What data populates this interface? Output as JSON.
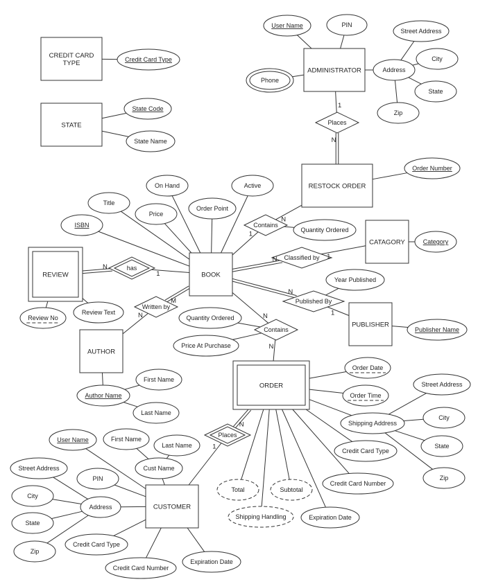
{
  "diagram": {
    "type": "entity-relationship",
    "entities": [
      {
        "id": "credit_card_type",
        "label_lines": [
          "CREDIT CARD",
          "TYPE"
        ],
        "weak": false
      },
      {
        "id": "state",
        "label_lines": [
          "STATE"
        ],
        "weak": false
      },
      {
        "id": "administrator",
        "label_lines": [
          "ADMINISTRATOR"
        ],
        "weak": false
      },
      {
        "id": "restock_order",
        "label_lines": [
          "RESTOCK ORDER"
        ],
        "weak": false
      },
      {
        "id": "catagory",
        "label_lines": [
          "CATAGORY"
        ],
        "weak": false
      },
      {
        "id": "book",
        "label_lines": [
          "BOOK"
        ],
        "weak": false
      },
      {
        "id": "review",
        "label_lines": [
          "REVIEW"
        ],
        "weak": true
      },
      {
        "id": "author",
        "label_lines": [
          "AUTHOR"
        ],
        "weak": false
      },
      {
        "id": "publisher",
        "label_lines": [
          "PUBLISHER"
        ],
        "weak": false
      },
      {
        "id": "order",
        "label_lines": [
          "ORDER"
        ],
        "weak": true
      },
      {
        "id": "customer",
        "label_lines": [
          "CUSTOMER"
        ],
        "weak": false
      }
    ],
    "relationships": [
      {
        "id": "admin_places",
        "label": "Places",
        "identifying": false
      },
      {
        "id": "restock_contains",
        "label": "Contains",
        "identifying": false
      },
      {
        "id": "classified_by",
        "label": "Classified by",
        "identifying": false
      },
      {
        "id": "has",
        "label": "has",
        "identifying": true
      },
      {
        "id": "written_by",
        "label": "Written by",
        "identifying": false
      },
      {
        "id": "published_by",
        "label": "Published By",
        "identifying": false
      },
      {
        "id": "order_contains",
        "label": "Contains",
        "identifying": false
      },
      {
        "id": "customer_places",
        "label": "Places",
        "identifying": true
      }
    ],
    "attributes": [
      {
        "id": "cct_type",
        "label": "Credit Card Type",
        "kind": "key"
      },
      {
        "id": "state_code",
        "label": "State Code",
        "kind": "key"
      },
      {
        "id": "state_name",
        "label": "State Name",
        "kind": "normal"
      },
      {
        "id": "admin_user",
        "label": "User Name",
        "kind": "key"
      },
      {
        "id": "admin_pin",
        "label": "PIN",
        "kind": "normal"
      },
      {
        "id": "admin_phone",
        "label": "Phone",
        "kind": "multivalued"
      },
      {
        "id": "admin_address",
        "label": "Address",
        "kind": "normal"
      },
      {
        "id": "admin_street",
        "label": "Street Address",
        "kind": "normal"
      },
      {
        "id": "admin_city",
        "label": "City",
        "kind": "normal"
      },
      {
        "id": "admin_state",
        "label": "State",
        "kind": "normal"
      },
      {
        "id": "admin_zip",
        "label": "Zip",
        "kind": "normal"
      },
      {
        "id": "order_number",
        "label": "Order Number",
        "kind": "key"
      },
      {
        "id": "restock_qty",
        "label": "Quantity Ordered",
        "kind": "normal"
      },
      {
        "id": "category",
        "label": "Category",
        "kind": "key"
      },
      {
        "id": "on_hand",
        "label": "On Hand",
        "kind": "normal"
      },
      {
        "id": "active",
        "label": "Active",
        "kind": "normal"
      },
      {
        "id": "title",
        "label": "Title",
        "kind": "normal"
      },
      {
        "id": "price",
        "label": "Price",
        "kind": "normal"
      },
      {
        "id": "order_point",
        "label": "Order Point",
        "kind": "normal"
      },
      {
        "id": "isbn",
        "label": "ISBN",
        "kind": "key"
      },
      {
        "id": "review_no",
        "label": "Review No",
        "kind": "partial-key"
      },
      {
        "id": "review_text",
        "label": "Review Text",
        "kind": "normal"
      },
      {
        "id": "author_name",
        "label": "Author Name",
        "kind": "key"
      },
      {
        "id": "author_first",
        "label": "First Name",
        "kind": "normal"
      },
      {
        "id": "author_last",
        "label": "Last Name",
        "kind": "normal"
      },
      {
        "id": "year_published",
        "label": "Year Published",
        "kind": "normal"
      },
      {
        "id": "publisher_name",
        "label": "Publisher Name",
        "kind": "key"
      },
      {
        "id": "oc_qty",
        "label": "Quantity Ordered",
        "kind": "normal"
      },
      {
        "id": "price_at_purchase",
        "label": "Price At Purchase",
        "kind": "normal"
      },
      {
        "id": "order_date",
        "label": "Order Date",
        "kind": "partial-key"
      },
      {
        "id": "order_time",
        "label": "Order Time",
        "kind": "partial-key"
      },
      {
        "id": "ship_address",
        "label": "Shipping Address",
        "kind": "normal"
      },
      {
        "id": "ship_street",
        "label": "Street Address",
        "kind": "normal"
      },
      {
        "id": "ship_city",
        "label": "City",
        "kind": "normal"
      },
      {
        "id": "ship_state",
        "label": "State",
        "kind": "normal"
      },
      {
        "id": "ship_zip",
        "label": "Zip",
        "kind": "normal"
      },
      {
        "id": "order_cc_type",
        "label": "Credit Card Type",
        "kind": "normal"
      },
      {
        "id": "order_cc_number",
        "label": "Credit Card Number",
        "kind": "normal"
      },
      {
        "id": "order_total",
        "label": "Total",
        "kind": "derived"
      },
      {
        "id": "order_subtotal",
        "label": "Subtotal",
        "kind": "derived"
      },
      {
        "id": "order_shipping",
        "label": "Shipping Handling",
        "kind": "derived"
      },
      {
        "id": "order_exp",
        "label": "Expiration Date",
        "kind": "normal"
      },
      {
        "id": "cust_user",
        "label": "User Name",
        "kind": "key"
      },
      {
        "id": "cust_first",
        "label": "First Name",
        "kind": "normal"
      },
      {
        "id": "cust_last",
        "label": "Last Name",
        "kind": "normal"
      },
      {
        "id": "cust_name",
        "label": "Cust Name",
        "kind": "normal"
      },
      {
        "id": "cust_pin",
        "label": "PIN",
        "kind": "normal"
      },
      {
        "id": "cust_street",
        "label": "Street Address",
        "kind": "normal"
      },
      {
        "id": "cust_city",
        "label": "City",
        "kind": "normal"
      },
      {
        "id": "cust_address",
        "label": "Address",
        "kind": "normal"
      },
      {
        "id": "cust_state",
        "label": "State",
        "kind": "normal"
      },
      {
        "id": "cust_zip",
        "label": "Zip",
        "kind": "normal"
      },
      {
        "id": "cust_cc_type",
        "label": "Credit Card Type",
        "kind": "normal"
      },
      {
        "id": "cust_cc_number",
        "label": "Credit Card Number",
        "kind": "normal"
      },
      {
        "id": "cust_exp",
        "label": "Expiration Date",
        "kind": "normal"
      }
    ],
    "links": [
      {
        "from": "credit_card_type",
        "to": "cct_type"
      },
      {
        "from": "state",
        "to": "state_code"
      },
      {
        "from": "state",
        "to": "state_name"
      },
      {
        "from": "administrator",
        "to": "admin_user"
      },
      {
        "from": "administrator",
        "to": "admin_pin"
      },
      {
        "from": "administrator",
        "to": "admin_phone"
      },
      {
        "from": "administrator",
        "to": "admin_address"
      },
      {
        "from": "admin_address",
        "to": "admin_street"
      },
      {
        "from": "admin_address",
        "to": "admin_city"
      },
      {
        "from": "admin_address",
        "to": "admin_state"
      },
      {
        "from": "admin_address",
        "to": "admin_zip"
      },
      {
        "from": "administrator",
        "to": "admin_places",
        "cardinality": "1"
      },
      {
        "from": "admin_places",
        "to": "restock_order",
        "cardinality": "N",
        "total": true
      },
      {
        "from": "restock_order",
        "to": "order_number"
      },
      {
        "from": "restock_order",
        "to": "restock_contains",
        "cardinality": "N"
      },
      {
        "from": "restock_contains",
        "to": "book",
        "cardinality": "1"
      },
      {
        "from": "restock_contains",
        "to": "restock_qty"
      },
      {
        "from": "catagory",
        "to": "category"
      },
      {
        "from": "catagory",
        "to": "classified_by",
        "cardinality": "1"
      },
      {
        "from": "classified_by",
        "to": "book",
        "cardinality": "N",
        "total": true
      },
      {
        "from": "book",
        "to": "on_hand"
      },
      {
        "from": "book",
        "to": "active"
      },
      {
        "from": "book",
        "to": "title"
      },
      {
        "from": "book",
        "to": "price"
      },
      {
        "from": "book",
        "to": "order_point"
      },
      {
        "from": "book",
        "to": "isbn"
      },
      {
        "from": "book",
        "to": "has",
        "cardinality": "1"
      },
      {
        "from": "has",
        "to": "review",
        "cardinality": "N",
        "total": true
      },
      {
        "from": "review",
        "to": "review_no"
      },
      {
        "from": "review",
        "to": "review_text"
      },
      {
        "from": "book",
        "to": "written_by",
        "cardinality": "M",
        "total": true
      },
      {
        "from": "written_by",
        "to": "author",
        "cardinality": "N"
      },
      {
        "from": "author",
        "to": "author_name"
      },
      {
        "from": "author_name",
        "to": "author_first"
      },
      {
        "from": "author_name",
        "to": "author_last"
      },
      {
        "from": "book",
        "to": "published_by",
        "cardinality": "N",
        "total": true
      },
      {
        "from": "published_by",
        "to": "publisher",
        "cardinality": "1"
      },
      {
        "from": "published_by",
        "to": "year_published"
      },
      {
        "from": "publisher",
        "to": "publisher_name"
      },
      {
        "from": "book",
        "to": "order_contains",
        "cardinality": "N"
      },
      {
        "from": "order_contains",
        "to": "order",
        "cardinality": "N"
      },
      {
        "from": "order_contains",
        "to": "oc_qty"
      },
      {
        "from": "order_contains",
        "to": "price_at_purchase"
      },
      {
        "from": "order",
        "to": "order_date"
      },
      {
        "from": "order",
        "to": "order_time"
      },
      {
        "from": "order",
        "to": "ship_address"
      },
      {
        "from": "ship_address",
        "to": "ship_street"
      },
      {
        "from": "ship_address",
        "to": "ship_city"
      },
      {
        "from": "ship_address",
        "to": "ship_state"
      },
      {
        "from": "ship_address",
        "to": "ship_zip"
      },
      {
        "from": "order",
        "to": "order_cc_type"
      },
      {
        "from": "order",
        "to": "order_cc_number"
      },
      {
        "from": "order",
        "to": "order_total"
      },
      {
        "from": "order",
        "to": "order_subtotal"
      },
      {
        "from": "order",
        "to": "order_shipping"
      },
      {
        "from": "order",
        "to": "order_exp"
      },
      {
        "from": "order",
        "to": "customer_places",
        "cardinality": "N",
        "total": true
      },
      {
        "from": "customer_places",
        "to": "customer",
        "cardinality": "1"
      },
      {
        "from": "customer",
        "to": "cust_user"
      },
      {
        "from": "customer",
        "to": "cust_name"
      },
      {
        "from": "cust_name",
        "to": "cust_first"
      },
      {
        "from": "cust_name",
        "to": "cust_last"
      },
      {
        "from": "customer",
        "to": "cust_pin"
      },
      {
        "from": "customer",
        "to": "cust_address"
      },
      {
        "from": "cust_address",
        "to": "cust_street"
      },
      {
        "from": "cust_address",
        "to": "cust_city"
      },
      {
        "from": "cust_address",
        "to": "cust_state"
      },
      {
        "from": "cust_address",
        "to": "cust_zip"
      },
      {
        "from": "customer",
        "to": "cust_cc_type"
      },
      {
        "from": "customer",
        "to": "cust_cc_number"
      },
      {
        "from": "customer",
        "to": "cust_exp"
      }
    ]
  }
}
